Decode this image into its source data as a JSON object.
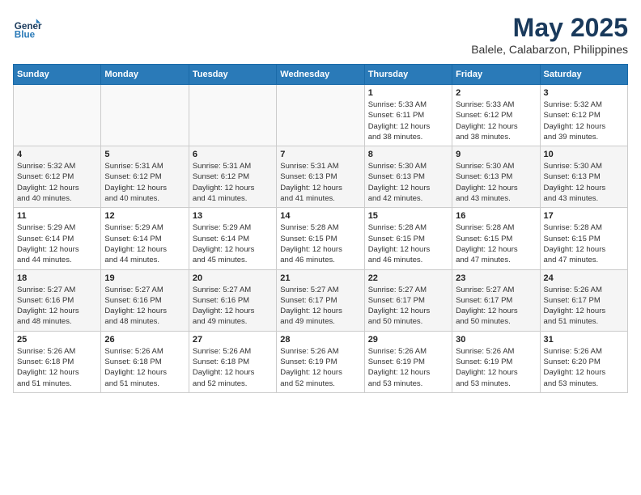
{
  "header": {
    "logo_line1": "General",
    "logo_line2": "Blue",
    "month_title": "May 2025",
    "location": "Balele, Calabarzon, Philippines"
  },
  "days_of_week": [
    "Sunday",
    "Monday",
    "Tuesday",
    "Wednesday",
    "Thursday",
    "Friday",
    "Saturday"
  ],
  "weeks": [
    [
      {
        "day": "",
        "info": ""
      },
      {
        "day": "",
        "info": ""
      },
      {
        "day": "",
        "info": ""
      },
      {
        "day": "",
        "info": ""
      },
      {
        "day": "1",
        "info": "Sunrise: 5:33 AM\nSunset: 6:11 PM\nDaylight: 12 hours\nand 38 minutes."
      },
      {
        "day": "2",
        "info": "Sunrise: 5:33 AM\nSunset: 6:12 PM\nDaylight: 12 hours\nand 38 minutes."
      },
      {
        "day": "3",
        "info": "Sunrise: 5:32 AM\nSunset: 6:12 PM\nDaylight: 12 hours\nand 39 minutes."
      }
    ],
    [
      {
        "day": "4",
        "info": "Sunrise: 5:32 AM\nSunset: 6:12 PM\nDaylight: 12 hours\nand 40 minutes."
      },
      {
        "day": "5",
        "info": "Sunrise: 5:31 AM\nSunset: 6:12 PM\nDaylight: 12 hours\nand 40 minutes."
      },
      {
        "day": "6",
        "info": "Sunrise: 5:31 AM\nSunset: 6:12 PM\nDaylight: 12 hours\nand 41 minutes."
      },
      {
        "day": "7",
        "info": "Sunrise: 5:31 AM\nSunset: 6:13 PM\nDaylight: 12 hours\nand 41 minutes."
      },
      {
        "day": "8",
        "info": "Sunrise: 5:30 AM\nSunset: 6:13 PM\nDaylight: 12 hours\nand 42 minutes."
      },
      {
        "day": "9",
        "info": "Sunrise: 5:30 AM\nSunset: 6:13 PM\nDaylight: 12 hours\nand 43 minutes."
      },
      {
        "day": "10",
        "info": "Sunrise: 5:30 AM\nSunset: 6:13 PM\nDaylight: 12 hours\nand 43 minutes."
      }
    ],
    [
      {
        "day": "11",
        "info": "Sunrise: 5:29 AM\nSunset: 6:14 PM\nDaylight: 12 hours\nand 44 minutes."
      },
      {
        "day": "12",
        "info": "Sunrise: 5:29 AM\nSunset: 6:14 PM\nDaylight: 12 hours\nand 44 minutes."
      },
      {
        "day": "13",
        "info": "Sunrise: 5:29 AM\nSunset: 6:14 PM\nDaylight: 12 hours\nand 45 minutes."
      },
      {
        "day": "14",
        "info": "Sunrise: 5:28 AM\nSunset: 6:15 PM\nDaylight: 12 hours\nand 46 minutes."
      },
      {
        "day": "15",
        "info": "Sunrise: 5:28 AM\nSunset: 6:15 PM\nDaylight: 12 hours\nand 46 minutes."
      },
      {
        "day": "16",
        "info": "Sunrise: 5:28 AM\nSunset: 6:15 PM\nDaylight: 12 hours\nand 47 minutes."
      },
      {
        "day": "17",
        "info": "Sunrise: 5:28 AM\nSunset: 6:15 PM\nDaylight: 12 hours\nand 47 minutes."
      }
    ],
    [
      {
        "day": "18",
        "info": "Sunrise: 5:27 AM\nSunset: 6:16 PM\nDaylight: 12 hours\nand 48 minutes."
      },
      {
        "day": "19",
        "info": "Sunrise: 5:27 AM\nSunset: 6:16 PM\nDaylight: 12 hours\nand 48 minutes."
      },
      {
        "day": "20",
        "info": "Sunrise: 5:27 AM\nSunset: 6:16 PM\nDaylight: 12 hours\nand 49 minutes."
      },
      {
        "day": "21",
        "info": "Sunrise: 5:27 AM\nSunset: 6:17 PM\nDaylight: 12 hours\nand 49 minutes."
      },
      {
        "day": "22",
        "info": "Sunrise: 5:27 AM\nSunset: 6:17 PM\nDaylight: 12 hours\nand 50 minutes."
      },
      {
        "day": "23",
        "info": "Sunrise: 5:27 AM\nSunset: 6:17 PM\nDaylight: 12 hours\nand 50 minutes."
      },
      {
        "day": "24",
        "info": "Sunrise: 5:26 AM\nSunset: 6:17 PM\nDaylight: 12 hours\nand 51 minutes."
      }
    ],
    [
      {
        "day": "25",
        "info": "Sunrise: 5:26 AM\nSunset: 6:18 PM\nDaylight: 12 hours\nand 51 minutes."
      },
      {
        "day": "26",
        "info": "Sunrise: 5:26 AM\nSunset: 6:18 PM\nDaylight: 12 hours\nand 51 minutes."
      },
      {
        "day": "27",
        "info": "Sunrise: 5:26 AM\nSunset: 6:18 PM\nDaylight: 12 hours\nand 52 minutes."
      },
      {
        "day": "28",
        "info": "Sunrise: 5:26 AM\nSunset: 6:19 PM\nDaylight: 12 hours\nand 52 minutes."
      },
      {
        "day": "29",
        "info": "Sunrise: 5:26 AM\nSunset: 6:19 PM\nDaylight: 12 hours\nand 53 minutes."
      },
      {
        "day": "30",
        "info": "Sunrise: 5:26 AM\nSunset: 6:19 PM\nDaylight: 12 hours\nand 53 minutes."
      },
      {
        "day": "31",
        "info": "Sunrise: 5:26 AM\nSunset: 6:20 PM\nDaylight: 12 hours\nand 53 minutes."
      }
    ]
  ]
}
